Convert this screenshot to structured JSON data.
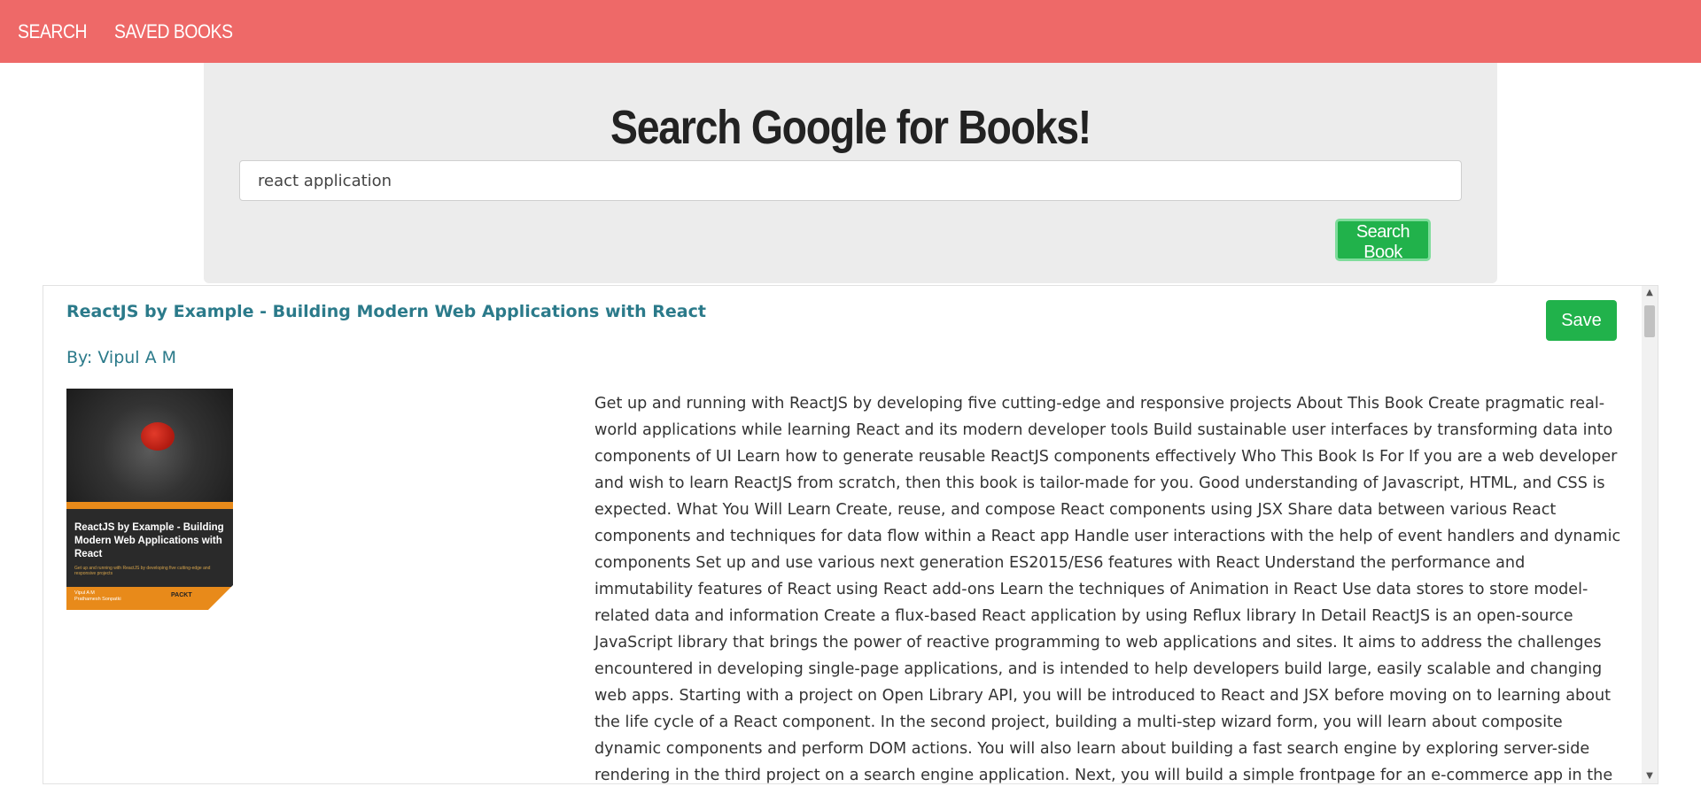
{
  "nav": {
    "items": [
      {
        "label": "SEARCH"
      },
      {
        "label": "SAVED BOOKS"
      }
    ]
  },
  "colors": {
    "navbar": "#ee6968",
    "accent_green": "#21b24b",
    "link_teal": "#2b7a8a",
    "jumbotron_bg": "#ececec"
  },
  "jumbotron": {
    "title": "Search Google for Books!",
    "search_value": "react application",
    "button_label": "Search Book"
  },
  "results": [
    {
      "title": "ReactJS by Example - Building Modern Web Applications with React",
      "author": "By: Vipul A M",
      "save_label": "Save",
      "cover": {
        "title": "ReactJS by Example - Building Modern Web Applications with React",
        "subtitle": "Get up and running with ReactJS by developing five cutting-edge and responsive projects",
        "authors": "Vipul A M\nPrathamesh Sonpatki",
        "publisher": "PACKT"
      },
      "description": "Get up and running with ReactJS by developing five cutting-edge and responsive projects About This Book Create pragmatic real-world applications while learning React and its modern developer tools Build sustainable user interfaces by transforming data into components of UI Learn how to generate reusable ReactJS components effectively Who This Book Is For If you are a web developer and wish to learn ReactJS from scratch, then this book is tailor-made for you. Good understanding of Javascript, HTML, and CSS is expected. What You Will Learn Create, reuse, and compose React components using JSX Share data between various React components and techniques for data flow within a React app Handle user interactions with the help of event handlers and dynamic components Set up and use various next generation ES2015/ES6 features with React Understand the performance and immutability features of React using React add-ons Learn the techniques of Animation in React Use data stores to store model-related data and information Create a flux-based React application by using Reflux library In Detail ReactJS is an open-source JavaScript library that brings the power of reactive programming to web applications and sites. It aims to address the challenges encountered in developing single-page applications, and is intended to help developers build large, easily scalable and changing web apps. Starting with a project on Open Library API, you will be introduced to React and JSX before moving on to learning about the life cycle of a React component. In the second project, building a multi-step wizard form, you will learn about composite dynamic components and perform DOM actions. You will also learn about building a fast search engine by exploring server-side rendering in the third project on a search engine application. Next, you will build a simple frontpage for an e-commerce app in the"
    }
  ]
}
